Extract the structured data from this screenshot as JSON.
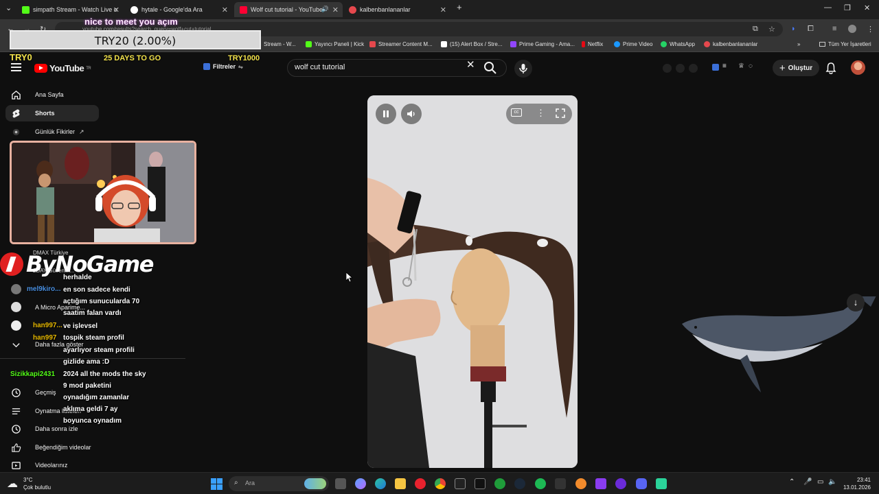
{
  "browser": {
    "tabs": [
      {
        "title": "simpath Stream - Watch Live o",
        "favicon_color": "#53fc18"
      },
      {
        "title": "hytale - Google'da Ara",
        "favicon_color": "#ffffff"
      },
      {
        "title": "Wolf cut tutorial - YouTube",
        "favicon_color": "#ff0033"
      },
      {
        "title": "kalbenbanlananlar",
        "favicon_color": "#e5484d"
      }
    ],
    "new_tab_label": "+",
    "url": "youtube.com/results?search_query=wolf+cut+tutorial",
    "bookmarks": [
      {
        "label": "Stream - W...",
        "color": "#53fc18"
      },
      {
        "label": "Yayıncı Paneli | Kick",
        "color": "#53fc18"
      },
      {
        "label": "Streamer Content M...",
        "color": "#e5484d"
      },
      {
        "label": "(15) Alert Box / Stre...",
        "color": "#ffffff"
      },
      {
        "label": "Prime Gaming - Ama...",
        "color": "#9146ff"
      },
      {
        "label": "Netflix",
        "color": "#e50914"
      },
      {
        "label": "Prime Video",
        "color": "#1a98ff"
      },
      {
        "label": "WhatsApp",
        "color": "#25d366"
      },
      {
        "label": "kalbenbanlananlar",
        "color": "#e5484d"
      }
    ],
    "all_bookmarks_label": "Tüm Yer İşaretleri"
  },
  "youtube": {
    "logo_text": "YouTube",
    "logo_suffix": "TR",
    "filters_label": "Filtreler",
    "search_value": "wolf cut tutorial",
    "create_label": "Oluştur",
    "sidebar": [
      {
        "label": "Ana Sayfa",
        "icon": "home-icon"
      },
      {
        "label": "Shorts",
        "icon": "shorts-icon"
      },
      {
        "label": "Günlük Fikirler",
        "icon": "ideas-icon"
      },
      {
        "label": "A Micro Aparime...",
        "icon": "channel-icon"
      },
      {
        "label": "Daha fazla göster",
        "icon": "chevron-down-icon"
      },
      {
        "label": "Geçmiş",
        "icon": "history-icon"
      },
      {
        "label": "Oynatma listeleri",
        "icon": "playlist-icon"
      },
      {
        "label": "Daha sonra izle",
        "icon": "watch-later-icon"
      },
      {
        "label": "Beğendiğim videolar",
        "icon": "like-icon"
      },
      {
        "label": "Videolarınız",
        "icon": "your-videos-icon"
      }
    ],
    "sidebar_partial": [
      "DMAX Türkiye",
      "2DAY Güvenlik..."
    ]
  },
  "overlay": {
    "goal_text": "TRY20 (2.00%)",
    "goal_left": "TRY0",
    "goal_right": "TRY1000",
    "days_to_go": "25 DAYS TO GO",
    "tts_message": "nice to meet you açım",
    "brand": "ByNoGame",
    "chat_users": [
      {
        "name": "mel9kiro...",
        "color": "#4a90e2"
      },
      {
        "name": "han997...",
        "color": "#e6b800"
      },
      {
        "name": "han997",
        "color": "#e6b800"
      },
      {
        "name": "Sizikkapi2431",
        "color": "#53fc18"
      }
    ],
    "chat_lines": [
      "herhalde",
      "en son sadece kendi",
      "açtığım sunucularda 70",
      "saatim falan vardı",
      "ve işlevsel",
      "tospik steam profil",
      "ayarlıyor steam profili",
      "gizlide ama :D",
      "2024 all the mods the sky",
      "9 mod paketini",
      "oynadığım zamanlar",
      "aklıma geldi 7 ay",
      "boyunca oynadım"
    ]
  },
  "taskbar": {
    "weather_temp": "3°C",
    "weather_desc": "Çok bulutlu",
    "search_placeholder": "Ara",
    "time": "23:41",
    "date": "13.01.2026"
  }
}
